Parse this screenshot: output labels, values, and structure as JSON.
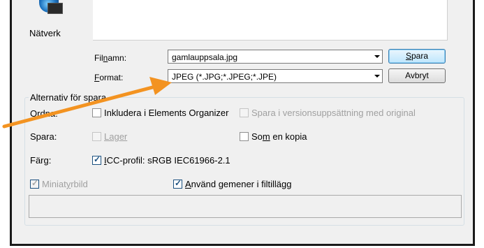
{
  "nav": {
    "network_label": "Nätverk"
  },
  "form": {
    "filename_label_pre": "Fil",
    "filename_label_u": "n",
    "filename_label_post": "amn:",
    "filename_value": "gamlauppsala.jpg",
    "format_label_u": "F",
    "format_label_post": "ormat:",
    "format_value": "JPEG (*.JPG;*.JPEG;*.JPE)",
    "save_button_u": "S",
    "save_button_post": "para",
    "cancel_button": "Avbryt"
  },
  "options": {
    "legend": "Alternativ för spara",
    "row_organize_label": "Ordna:",
    "include_organizer": {
      "label": "Inkludera i Elements Organizer",
      "checked": false
    },
    "version_set": {
      "label": "Spara i versionsuppsättning med original",
      "checked": false,
      "disabled": true
    },
    "row_save_label": "Spara:",
    "layers": {
      "label": "Lager",
      "checked": false,
      "disabled": true
    },
    "as_copy": {
      "label_pre": "So",
      "label_u": "m",
      "label_post": " en kopia",
      "checked": false
    },
    "row_color_label": "Färg:",
    "icc": {
      "label_u": "I",
      "label_post": "CC-profil:  sRGB IEC61966-2.1",
      "checked": true
    },
    "thumbnail": {
      "label_pre": "Miniat",
      "label_u": "y",
      "label_post": "rbild",
      "checked": true,
      "disabled": true
    },
    "lowercase": {
      "label_pre": "",
      "label_u": "A",
      "label_post": "nvänd gemener i filtillägg",
      "checked": true
    }
  },
  "colors": {
    "annotation_arrow": "#f39321",
    "dialog_bg": "#f0f0f0"
  }
}
